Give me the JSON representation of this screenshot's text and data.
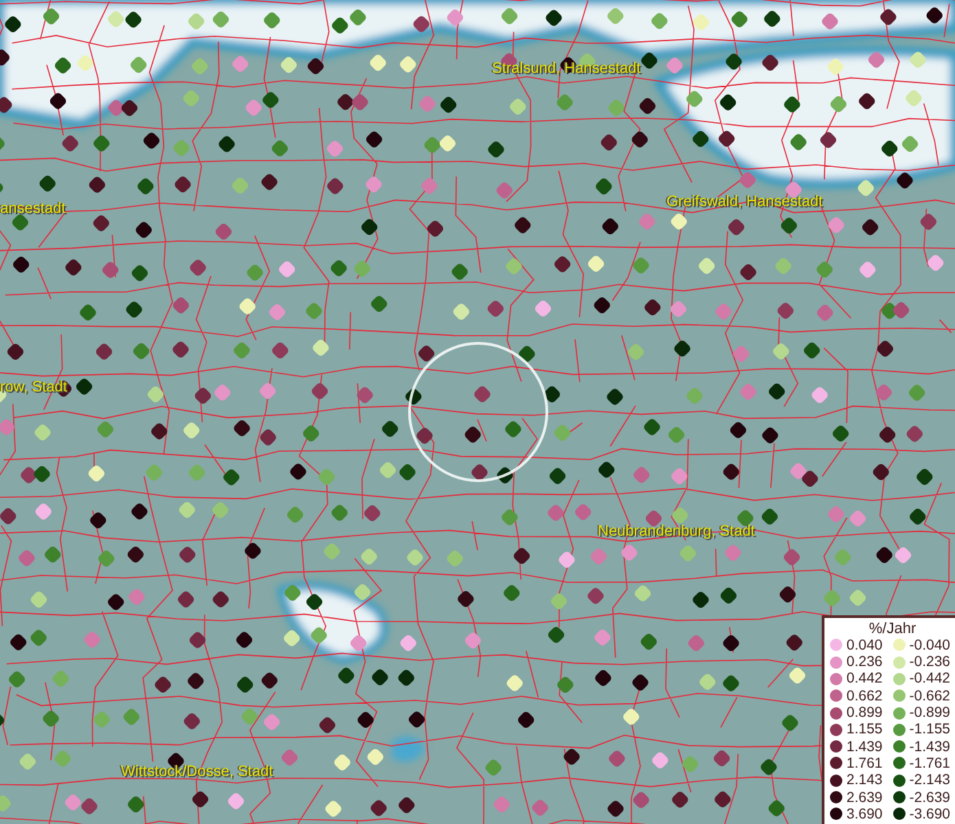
{
  "map": {
    "place_labels": [
      {
        "text": "Stralsund, Hansestadt"
      },
      {
        "text": "ansestadt"
      },
      {
        "text": "Greifswald, Hansestadt"
      },
      {
        "text": "row, Stadt"
      },
      {
        "text": "Neubrandenburg, Stadt"
      },
      {
        "text": "Wittstock/Dosse, Stadt"
      }
    ]
  },
  "legend": {
    "title": "%/Jahr",
    "rows": [
      {
        "positive": {
          "value": "0.040",
          "color": "#f4b6e4"
        },
        "negative": {
          "value": "-0.040",
          "color": "#eef3b4"
        }
      },
      {
        "positive": {
          "value": "0.236",
          "color": "#e594c6"
        },
        "negative": {
          "value": "-0.236",
          "color": "#d2e8a6"
        }
      },
      {
        "positive": {
          "value": "0.442",
          "color": "#d37aa8"
        },
        "negative": {
          "value": "-0.442",
          "color": "#b4d88e"
        }
      },
      {
        "positive": {
          "value": "0.662",
          "color": "#c0628e"
        },
        "negative": {
          "value": "-0.662",
          "color": "#96c674"
        }
      },
      {
        "positive": {
          "value": "0.899",
          "color": "#a84c72"
        },
        "negative": {
          "value": "-0.899",
          "color": "#76b25a"
        }
      },
      {
        "positive": {
          "value": "1.155",
          "color": "#8e3a58"
        },
        "negative": {
          "value": "-1.155",
          "color": "#589a40"
        }
      },
      {
        "positive": {
          "value": "1.439",
          "color": "#742a42"
        },
        "negative": {
          "value": "-1.439",
          "color": "#3e822c"
        }
      },
      {
        "positive": {
          "value": "1.761",
          "color": "#5c1c2e"
        },
        "negative": {
          "value": "-1.761",
          "color": "#286a1c"
        }
      },
      {
        "positive": {
          "value": "2.143",
          "color": "#461220"
        },
        "negative": {
          "value": "-2.143",
          "color": "#185212"
        }
      },
      {
        "positive": {
          "value": "2.639",
          "color": "#320a14"
        },
        "negative": {
          "value": "-2.639",
          "color": "#0e3c0c"
        }
      },
      {
        "positive": {
          "value": "3.690",
          "color": "#22040c"
        },
        "negative": {
          "value": "-3.690",
          "color": "#082a08"
        }
      }
    ]
  }
}
